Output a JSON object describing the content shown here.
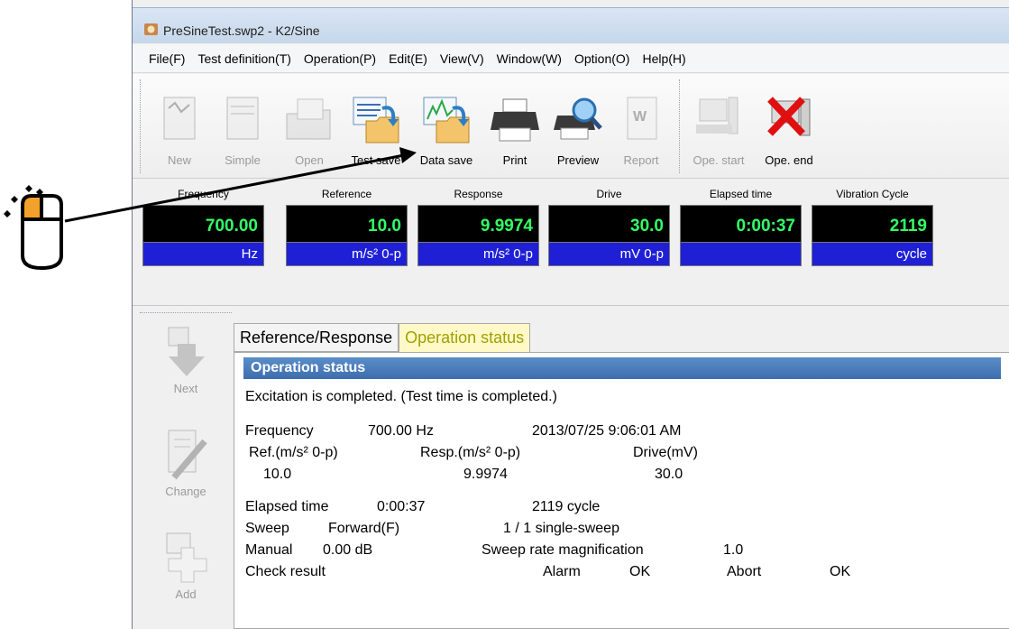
{
  "window": {
    "title": "PreSineTest.swp2 - K2/Sine"
  },
  "menu": [
    "File(F)",
    "Test definition(T)",
    "Operation(P)",
    "Edit(E)",
    "View(V)",
    "Window(W)",
    "Option(O)",
    "Help(H)"
  ],
  "toolbar": {
    "new": "New",
    "simple": "Simple",
    "open": "Open",
    "test_save": "Test save",
    "data_save": "Data save",
    "print": "Print",
    "preview": "Preview",
    "report": "Report",
    "ope_start": "Ope. start",
    "ope_end": "Ope. end"
  },
  "meters": [
    {
      "label": "Frequency",
      "value": "700.00",
      "unit": "Hz"
    },
    {
      "label": "Reference",
      "value": "10.0",
      "unit": "m/s² 0-p"
    },
    {
      "label": "Response",
      "value": "9.9974",
      "unit": "m/s² 0-p"
    },
    {
      "label": "Drive",
      "value": "30.0",
      "unit": "mV 0-p"
    },
    {
      "label": "Elapsed time",
      "value": "0:00:37",
      "unit": ""
    },
    {
      "label": "Vibration Cycle",
      "value": "2119",
      "unit": "cycle"
    }
  ],
  "side": {
    "next": "Next",
    "change": "Change",
    "add": "Add"
  },
  "tabs": {
    "ref_resp": "Reference/Response",
    "op_status": "Operation status"
  },
  "status": {
    "header": "Operation status",
    "message": "Excitation is completed. (Test time is completed.)",
    "freq_label": "Frequency",
    "freq_value": "700.00 Hz",
    "timestamp": "2013/07/25 9:06:01 AM",
    "ref_label": "Ref.(m/s² 0-p)",
    "resp_label": "Resp.(m/s² 0-p)",
    "drive_label": "Drive(mV)",
    "ref_value": "10.0",
    "resp_value": "9.9974",
    "drive_value": "30.0",
    "elapsed_label": "Elapsed time",
    "elapsed_value": "0:00:37",
    "cycles": "2119 cycle",
    "sweep_label": "Sweep",
    "sweep_dir": "Forward(F)",
    "sweep_count": "1 / 1 single-sweep",
    "manual_label": "Manual",
    "manual_value": "0.00 dB",
    "rate_label": "Sweep rate magnification",
    "rate_value": "1.0",
    "check_label": "Check result",
    "alarm_label": "Alarm",
    "alarm_value": "OK",
    "abort_label": "Abort",
    "abort_value": "OK"
  },
  "colors": {
    "meter_bg": "#000000",
    "meter_text": "#33ff66",
    "unit_bg": "#1f20d6",
    "tab_active": "#fff9c8",
    "header_bg": "#4a7dbd",
    "cursor_highlight": "#f2a22a"
  }
}
